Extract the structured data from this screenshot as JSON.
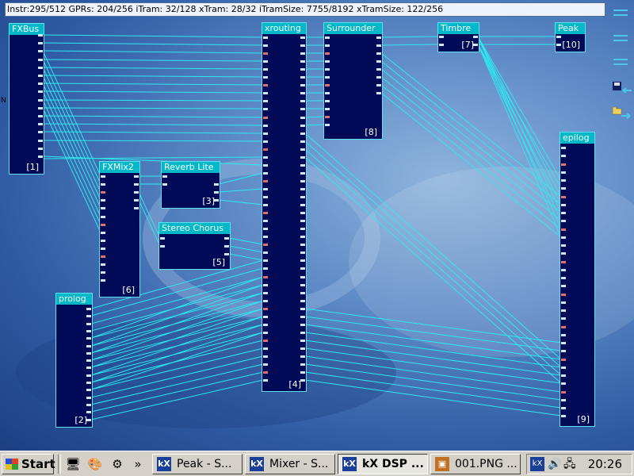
{
  "status": "Instr:295/512 GPRs: 204/256 iTram: 32/128 xTram: 28/32 iTramSize: 7755/8192 xTramSize: 122/256",
  "blocks": {
    "fxbus": {
      "title": "FXBus",
      "num": "[1]"
    },
    "fxmix2": {
      "title": "FXMix2",
      "num": "[6]"
    },
    "reverb": {
      "title": "Reverb Lite",
      "num": "[3]"
    },
    "chorus": {
      "title": "Stereo Chorus",
      "num": "[5]"
    },
    "prolog": {
      "title": "prolog",
      "num": "[2]"
    },
    "xrouting": {
      "title": "xrouting",
      "num": "[4]"
    },
    "surrounder": {
      "title": "Surrounder",
      "num": "[8]"
    },
    "timbre": {
      "title": "Timbre",
      "num": "[7]"
    },
    "peak": {
      "title": "Peak",
      "num": "[10]"
    },
    "epilog": {
      "title": "epilog",
      "num": "[9]"
    }
  },
  "taskbar": {
    "start": "Start",
    "quick_more": "»",
    "buttons": [
      {
        "label": "Peak - S..."
      },
      {
        "label": "Mixer - S..."
      },
      {
        "label": "kX DSP ..."
      },
      {
        "label": "001.PNG ..."
      }
    ],
    "clock": "20:26"
  },
  "side_label": "N",
  "colors": {
    "block": "#000a56",
    "title": "#00b8c8",
    "wire": "#2ee8f0",
    "desktop": "#3a66ad"
  }
}
